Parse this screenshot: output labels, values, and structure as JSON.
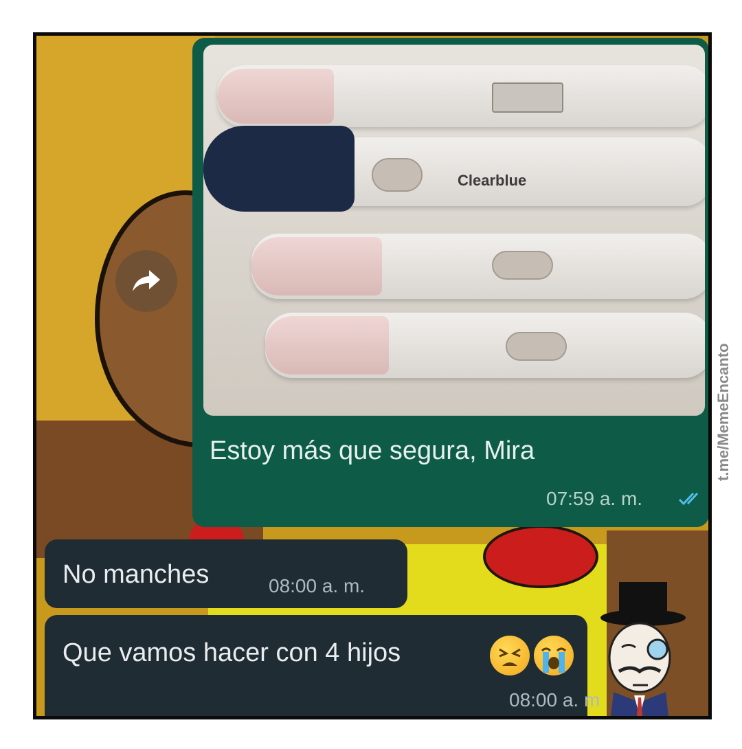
{
  "chat": {
    "outgoing": {
      "text": "Estoy más que segura, Mira",
      "time": "07:59 a. m.",
      "photo_brand": "Clearblue"
    },
    "incoming": [
      {
        "text": "No manches",
        "time": "08:00 a. m."
      },
      {
        "text": "Que vamos hacer con 4 hijos",
        "time": "08:00 a. m"
      }
    ]
  },
  "watermark": "t.me/MemeEncanto",
  "icons": {
    "forward": "forward-arrow-icon",
    "read_receipt": "double-check-icon",
    "emoji1": "tired-face-emoji",
    "emoji2": "loudly-crying-face-emoji",
    "sticker": "monocle-gentleman-sticker"
  },
  "colors": {
    "outgoing_bubble": "#0e5b48",
    "incoming_bubble": "#202c33",
    "read_tick": "#53bdeb"
  }
}
